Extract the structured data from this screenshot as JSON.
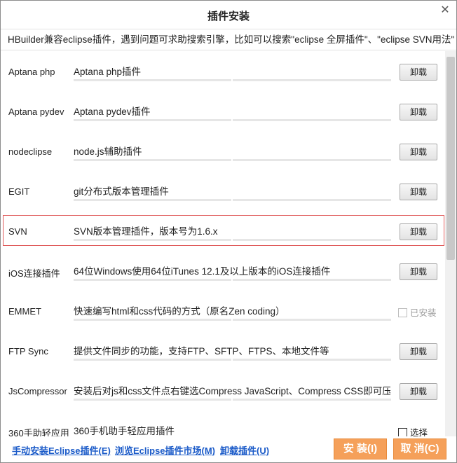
{
  "dialog": {
    "title": "插件安装",
    "notice": "HBuilder兼容eclipse插件，遇到问题可求助搜索引擎，比如可以搜索\"eclipse 全屏插件\"、\"eclipse SVN用法\""
  },
  "plugins": [
    {
      "name": "Aptana php",
      "description": "Aptana php插件",
      "action": "卸载"
    },
    {
      "name": "Aptana pydev",
      "description": "Aptana pydev插件",
      "action": "卸载"
    },
    {
      "name": "nodeclipse",
      "description": "node.js辅助插件",
      "action": "卸载"
    },
    {
      "name": "EGIT",
      "description": "git分布式版本管理插件",
      "action": "卸载"
    },
    {
      "name": "SVN",
      "description": "SVN版本管理插件，版本号为1.6.x",
      "action": "卸载"
    },
    {
      "name": "iOS连接插件",
      "description": "64位Windows使用64位iTunes 12.1及以上版本的iOS连接插件",
      "action": "卸载"
    },
    {
      "name": "EMMET",
      "description": "快速编写html和css代码的方式（原名Zen coding）",
      "status": "已安装"
    },
    {
      "name": "FTP Sync",
      "description": "提供文件同步的功能，支持FTP、SFTP、FTPS、本地文件等",
      "action": "卸载"
    },
    {
      "name": "JsCompressor",
      "description": "安装后对js和css文件点右键选Compress JavaScript、Compress CSS即可压缩",
      "action": "卸载"
    },
    {
      "name": "360手助轻应用",
      "description": "360手机助手轻应用插件",
      "status": "选择"
    }
  ],
  "footer": {
    "manual_install": "手动安装Eclipse插件(E)",
    "browse_market": "浏览Eclipse插件市场(M)",
    "uninstall": "卸载插件(U)",
    "install": "安 装(I)",
    "cancel": "取 消(C)"
  },
  "colors": {
    "accent_button": "#f5a05a",
    "link": "#1a5ac8",
    "selection_border": "#e05b5b"
  }
}
